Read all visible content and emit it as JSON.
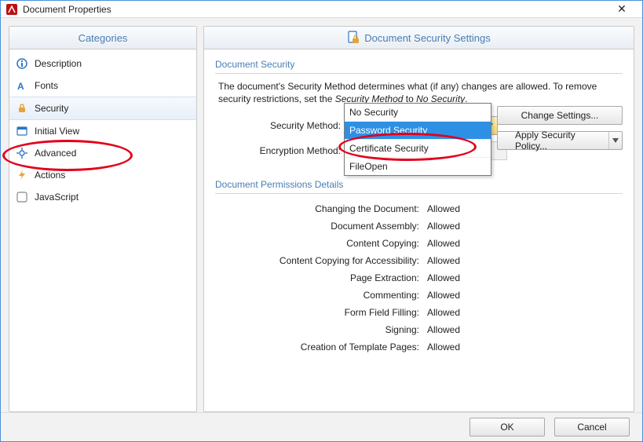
{
  "window": {
    "title": "Document Properties"
  },
  "sidebar": {
    "header": "Categories",
    "items": [
      {
        "label": "Description",
        "icon": "info-icon"
      },
      {
        "label": "Fonts",
        "icon": "font-icon"
      },
      {
        "label": "Security",
        "icon": "lock-icon",
        "selected": true
      },
      {
        "label": "Initial View",
        "icon": "view-icon"
      },
      {
        "label": "Advanced",
        "icon": "gear-icon"
      },
      {
        "label": "Actions",
        "icon": "bolt-icon"
      },
      {
        "label": "JavaScript",
        "icon": "js-icon"
      }
    ]
  },
  "main": {
    "header": "Document Security Settings",
    "group1_label": "Document Security",
    "description_a": "The document's Security Method determines what (if any) changes are allowed. To remove security restrictions, set the ",
    "description_i1": "Security Method",
    "description_mid": " to ",
    "description_i2": "No Security",
    "description_end": ".",
    "security_method_label": "Security Method:",
    "security_method_value": "Password Security",
    "encryption_method_label": "Encryption Method:",
    "encryption_method_value": "",
    "change_settings_label": "Change Settings...",
    "apply_policy_label": "Apply Security Policy...",
    "dropdown_options": [
      "No Security",
      "Password Security",
      "Certificate Security",
      "FileOpen"
    ],
    "group2_label": "Document Permissions Details",
    "permissions": [
      {
        "label": "Changing the Document:",
        "value": "Allowed"
      },
      {
        "label": "Document Assembly:",
        "value": "Allowed"
      },
      {
        "label": "Content Copying:",
        "value": "Allowed"
      },
      {
        "label": "Content Copying for Accessibility:",
        "value": "Allowed"
      },
      {
        "label": "Page Extraction:",
        "value": "Allowed"
      },
      {
        "label": "Commenting:",
        "value": "Allowed"
      },
      {
        "label": "Form Field Filling:",
        "value": "Allowed"
      },
      {
        "label": "Signing:",
        "value": "Allowed"
      },
      {
        "label": "Creation of Template Pages:",
        "value": "Allowed"
      }
    ]
  },
  "footer": {
    "ok": "OK",
    "cancel": "Cancel"
  }
}
